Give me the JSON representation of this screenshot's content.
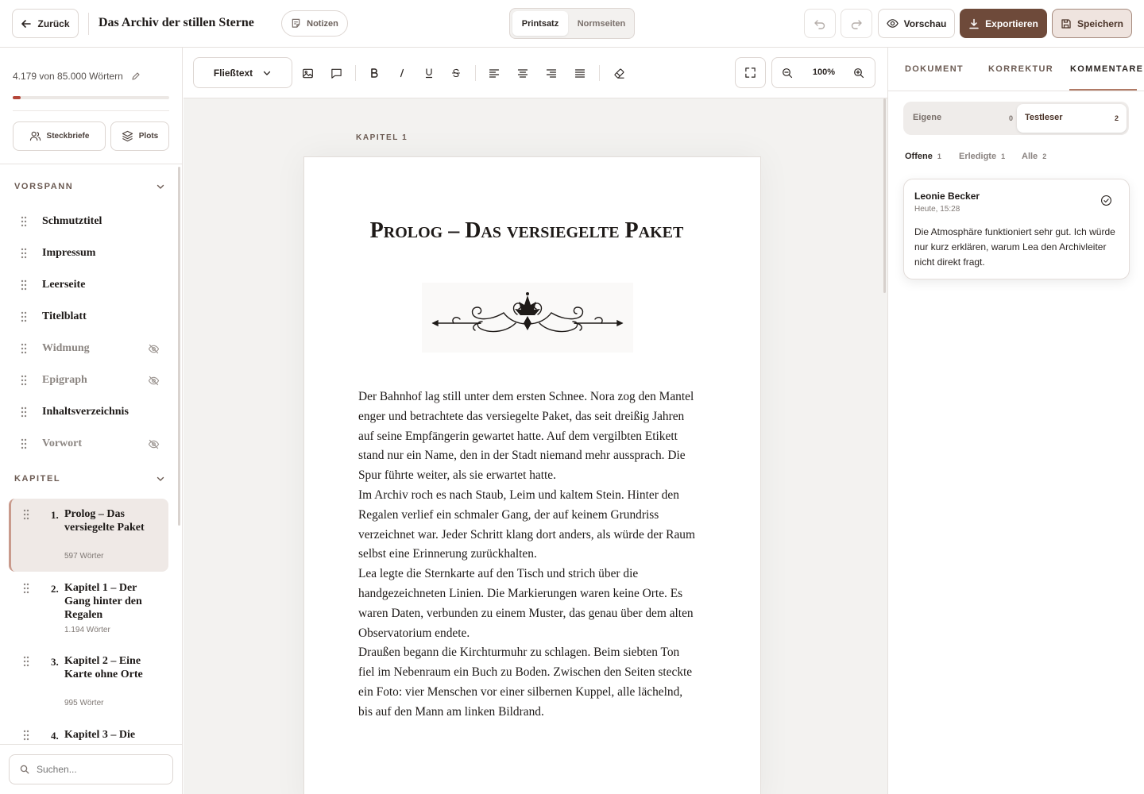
{
  "header": {
    "back_label": "Zurück",
    "book_title": "Das Archiv der stillen Sterne",
    "notes_label": "Notizen",
    "view_toggle": {
      "active": "Printsatz",
      "inactive": "Normseiten"
    },
    "preview_label": "Vorschau",
    "export_label": "Exportieren",
    "save_label": "Speichern"
  },
  "sidebar": {
    "word_count": "4.179 von 85.000 Wörtern",
    "progress_fraction": 0.049,
    "profiles_label": "Steckbriefe",
    "plots_label": "Plots",
    "frontmatter_title": "VORSPANN",
    "frontmatter": [
      {
        "label": "Schmutztitel",
        "hidden": false
      },
      {
        "label": "Impressum",
        "hidden": false
      },
      {
        "label": "Leerseite",
        "hidden": false
      },
      {
        "label": "Titelblatt",
        "hidden": false
      },
      {
        "label": "Widmung",
        "hidden": true
      },
      {
        "label": "Epigraph",
        "hidden": true
      },
      {
        "label": "Inhaltsverzeichnis",
        "hidden": false
      },
      {
        "label": "Vorwort",
        "hidden": true
      }
    ],
    "chapters_title": "KAPITEL",
    "chapters": [
      {
        "num": "1.",
        "title": "Prolog – Das versiegelte Paket",
        "words": "597 Wörter"
      },
      {
        "num": "2.",
        "title": "Kapitel 1 – Der Gang hinter den Regalen",
        "words": "1.194 Wörter"
      },
      {
        "num": "3.",
        "title": "Kapitel 2 – Eine Karte ohne Orte",
        "words": "995 Wörter"
      },
      {
        "num": "4.",
        "title": "Kapitel 3 – Die",
        "words": ""
      }
    ],
    "search_placeholder": "Suchen..."
  },
  "toolbar": {
    "style_select": "Fließtext",
    "zoom": "100%"
  },
  "document": {
    "chapter_kicker": "KAPITEL 1",
    "chapter_title": "Prolog – Das versiegelte Paket",
    "paragraphs": [
      "Der Bahnhof lag still unter dem ersten Schnee. Nora zog den Mantel enger und betrachtete das versiegelte Paket, das seit dreißig Jahren auf seine Empfängerin gewartet hatte. Auf dem vergilbten Etikett stand nur ein Name, den in der Stadt niemand mehr aussprach. Die Spur führte weiter, als sie erwartet hatte.",
      "Im Archiv roch es nach Staub, Leim und kaltem Stein. Hinter den Regalen verlief ein schmaler Gang, der auf keinem Grundriss verzeichnet war. Jeder Schritt klang dort anders, als würde der Raum selbst eine Erinnerung zurückhalten.",
      "Lea legte die Sternkarte auf den Tisch und strich über die handgezeichneten Linien. Die Markierungen waren keine Orte. Es waren Daten, verbunden zu einem Muster, das genau über dem alten Observatorium endete.",
      "Draußen begann die Kirchturmuhr zu schlagen. Beim siebten Ton fiel im Nebenraum ein Buch zu Boden. Zwischen den Seiten steckte ein Foto: vier Menschen vor einer silbernen Kuppel, alle lächelnd, bis auf den Mann am linken Bildrand."
    ]
  },
  "right_panel": {
    "tabs": [
      "DOKUMENT",
      "KORREKTUR",
      "KOMMENTARE"
    ],
    "active_tab": "KOMMENTARE",
    "segments": [
      {
        "label": "Eigene",
        "count": "0"
      },
      {
        "label": "Testleser",
        "count": "2"
      }
    ],
    "filters": [
      {
        "label": "Offene",
        "count": "1"
      },
      {
        "label": "Erledigte",
        "count": "1"
      },
      {
        "label": "Alle",
        "count": "2"
      }
    ],
    "comment": {
      "author": "Leonie Becker",
      "time": "Heute, 15:28",
      "text": "Die Atmosphäre funktioniert sehr gut. Ich würde nur kurz erklären, warum Lea den Archivleiter nicht direkt fragt."
    }
  },
  "colors": {
    "accent": "#6e4a3a",
    "accent_light": "#efe4df",
    "progress": "#b5473a",
    "border": "#e6e2df"
  }
}
